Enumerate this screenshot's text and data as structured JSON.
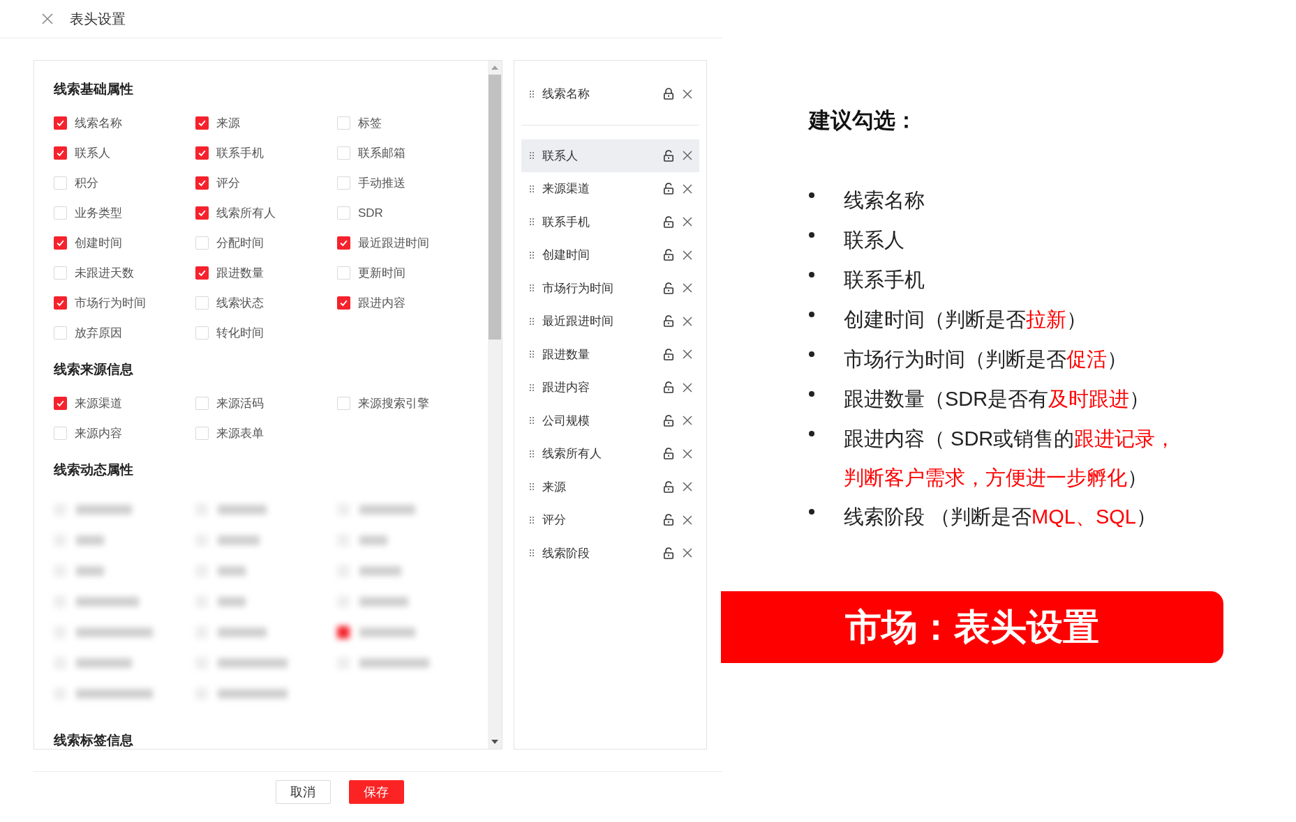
{
  "dialog": {
    "title": "表头设置",
    "sections": [
      {
        "title": "线索基础属性",
        "items": [
          {
            "label": "线索名称",
            "checked": true
          },
          {
            "label": "来源",
            "checked": true
          },
          {
            "label": "标签",
            "checked": false
          },
          {
            "label": "联系人",
            "checked": true
          },
          {
            "label": "联系手机",
            "checked": true
          },
          {
            "label": "联系邮箱",
            "checked": false
          },
          {
            "label": "积分",
            "checked": false
          },
          {
            "label": "评分",
            "checked": true
          },
          {
            "label": "手动推送",
            "checked": false
          },
          {
            "label": "业务类型",
            "checked": false
          },
          {
            "label": "线索所有人",
            "checked": true
          },
          {
            "label": "SDR",
            "checked": false
          },
          {
            "label": "创建时间",
            "checked": true
          },
          {
            "label": "分配时间",
            "checked": false
          },
          {
            "label": "最近跟进时间",
            "checked": true
          },
          {
            "label": "未跟进天数",
            "checked": false
          },
          {
            "label": "跟进数量",
            "checked": true
          },
          {
            "label": "更新时间",
            "checked": false
          },
          {
            "label": "市场行为时间",
            "checked": true
          },
          {
            "label": "线索状态",
            "checked": false
          },
          {
            "label": "跟进内容",
            "checked": true
          },
          {
            "label": "放弃原因",
            "checked": false
          },
          {
            "label": "转化时间",
            "checked": false
          }
        ]
      },
      {
        "title": "线索来源信息",
        "items": [
          {
            "label": "来源渠道",
            "checked": true
          },
          {
            "label": "来源活码",
            "checked": false
          },
          {
            "label": "来源搜索引擎",
            "checked": false
          },
          {
            "label": "来源内容",
            "checked": false
          },
          {
            "label": "来源表单",
            "checked": false
          }
        ]
      },
      {
        "title": "线索动态属性",
        "blurred": true
      },
      {
        "title": "线索标签信息"
      }
    ],
    "selected_columns": [
      {
        "label": "线索名称",
        "locked": true,
        "highlighted": false
      },
      {
        "label": "联系人",
        "locked": false,
        "highlighted": true
      },
      {
        "label": "来源渠道",
        "locked": false,
        "highlighted": false
      },
      {
        "label": "联系手机",
        "locked": false,
        "highlighted": false
      },
      {
        "label": "创建时间",
        "locked": false,
        "highlighted": false
      },
      {
        "label": "市场行为时间",
        "locked": false,
        "highlighted": false
      },
      {
        "label": "最近跟进时间",
        "locked": false,
        "highlighted": false
      },
      {
        "label": "跟进数量",
        "locked": false,
        "highlighted": false
      },
      {
        "label": "跟进内容",
        "locked": false,
        "highlighted": false
      },
      {
        "label": "公司规模",
        "locked": false,
        "highlighted": false
      },
      {
        "label": "线索所有人",
        "locked": false,
        "highlighted": false
      },
      {
        "label": "来源",
        "locked": false,
        "highlighted": false
      },
      {
        "label": "评分",
        "locked": false,
        "highlighted": false
      },
      {
        "label": "线索阶段",
        "locked": false,
        "highlighted": false
      }
    ],
    "buttons": [
      {
        "label": "取消",
        "kind": "secondary"
      },
      {
        "label": "保存",
        "kind": "primary"
      }
    ]
  },
  "annotation": {
    "title": "建议勾选：",
    "bullets": [
      [
        {
          "text": "线索名称",
          "kind": "plain"
        }
      ],
      [
        {
          "text": "联系人",
          "kind": "plain"
        }
      ],
      [
        {
          "text": "联系手机",
          "kind": "plain"
        }
      ],
      [
        {
          "text": "创建时间（判断是否",
          "kind": "plain"
        },
        {
          "text": "拉新",
          "kind": "highlight"
        },
        {
          "text": "）",
          "kind": "plain"
        }
      ],
      [
        {
          "text": "市场行为时间（判断是否",
          "kind": "plain"
        },
        {
          "text": "促活",
          "kind": "highlight"
        },
        {
          "text": "）",
          "kind": "plain"
        }
      ],
      [
        {
          "text": "跟进数量（SDR是否有",
          "kind": "plain"
        },
        {
          "text": "及时跟进",
          "kind": "highlight"
        },
        {
          "text": "）",
          "kind": "plain"
        }
      ],
      [
        {
          "text": "跟进内容（ SDR或销售的",
          "kind": "plain"
        },
        {
          "text": "跟进记录，判断客户需求，方便进一步孵化",
          "kind": "highlight"
        },
        {
          "text": "）",
          "kind": "plain"
        }
      ],
      [
        {
          "text": "线索阶段 （判断是否",
          "kind": "plain"
        },
        {
          "text": "MQL、SQL",
          "kind": "highlight"
        },
        {
          "text": "）",
          "kind": "plain"
        }
      ]
    ],
    "banner": "市场：表头设置"
  }
}
